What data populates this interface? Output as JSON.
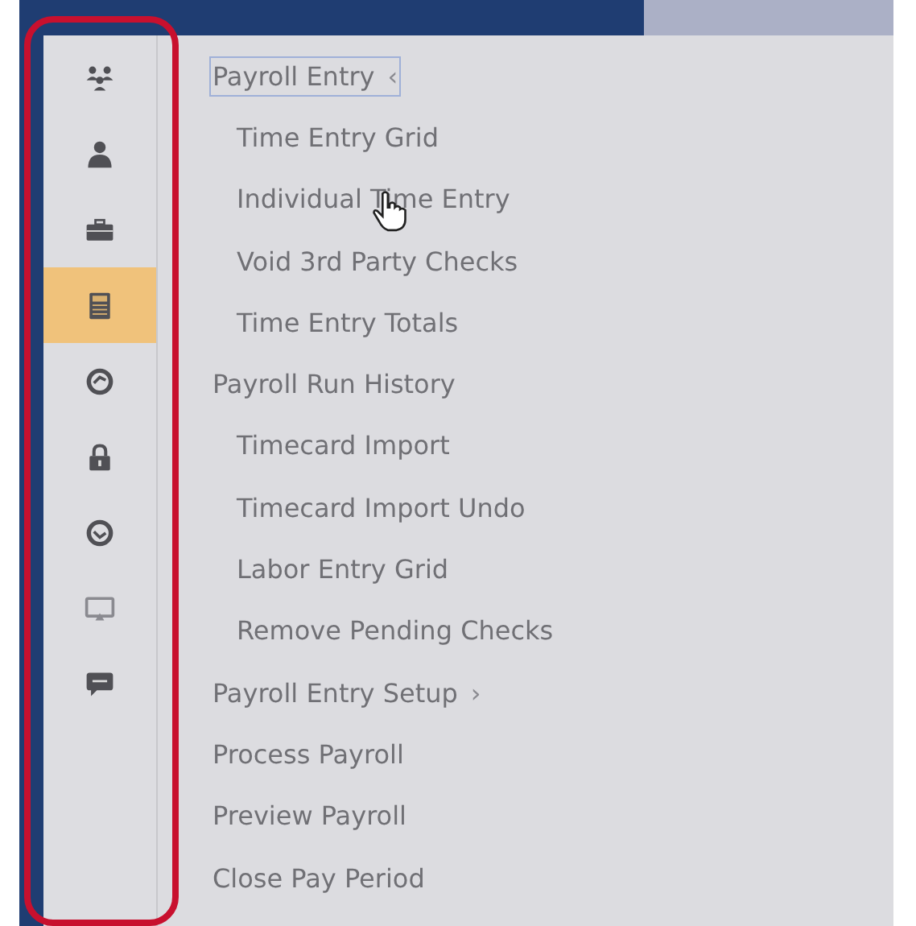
{
  "sidebar": {
    "icons": [
      {
        "selected": false
      },
      {
        "selected": false
      },
      {
        "selected": false
      },
      {
        "selected": true
      },
      {
        "selected": false
      },
      {
        "selected": false
      },
      {
        "selected": false
      },
      {
        "selected": false
      },
      {
        "selected": false
      }
    ]
  },
  "menu": {
    "items": [
      {
        "label": "Payroll Entry",
        "caret": "‹",
        "selected": true,
        "children": [
          {
            "label": "Time Entry Grid"
          },
          {
            "label": "Individual Time Entry"
          },
          {
            "label": "Void 3rd Party Checks"
          },
          {
            "label": "Time Entry Totals"
          }
        ]
      },
      {
        "label": "Payroll Run History",
        "selected": false,
        "children": [
          {
            "label": "Timecard Import"
          },
          {
            "label": "Timecard Import Undo"
          },
          {
            "label": "Labor Entry Grid"
          },
          {
            "label": "Remove Pending Checks"
          }
        ]
      },
      {
        "label": "Payroll Entry Setup",
        "caret": "›",
        "selected": false
      },
      {
        "label": "Process Payroll",
        "selected": false
      },
      {
        "label": "Preview Payroll",
        "selected": false
      },
      {
        "label": "Close Pay Period",
        "selected": false
      }
    ]
  }
}
